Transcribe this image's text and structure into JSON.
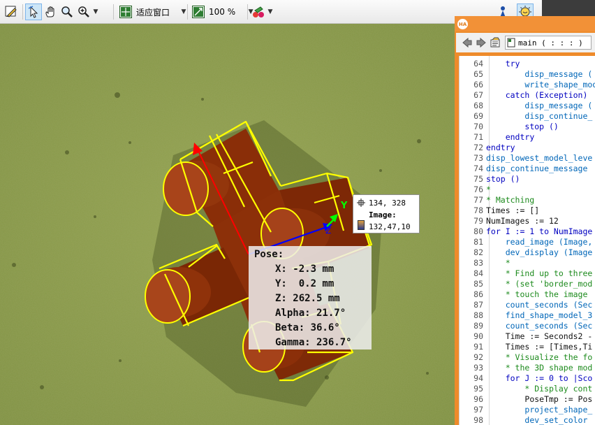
{
  "toolbar": {
    "zoom_fit_label": "适应窗口",
    "zoom_percent_label": "100 %"
  },
  "icons": {
    "edit": "pencil-edit-icon",
    "pointer": "pointer-arrow-icon",
    "pan": "pan-hand-icon",
    "magnify": "magnifier-icon",
    "zoom": "zoom-in-icon",
    "fit": "fit-window-icon",
    "scale": "zoom-scale-icon",
    "color": "color-paint-icon",
    "inspect": "inspect-icon",
    "lamp": "lamp-icon"
  },
  "graphics": {
    "pose": {
      "heading": "Pose:",
      "x": "X: -2.3 mm",
      "y": "Y:  0.2 mm",
      "z": "Z: 262.5 mm",
      "alpha": "Alpha: 21.7°",
      "beta": "Beta: 36.6°",
      "gamma": "Gamma: 236.7°"
    },
    "axis_labels": {
      "x": "X",
      "y": "Y",
      "z": "Z"
    },
    "pixel_info": {
      "coords": "134, 328",
      "label": "Image:",
      "value": "132,47,10"
    },
    "colors": {
      "background": "#8a9b4a",
      "object": "#8a2e08",
      "contour": "#ffff00"
    }
  },
  "program": {
    "logo": "HA",
    "procedure": "main ( : : : )",
    "lines": [
      {
        "n": "64",
        "indent": "    ",
        "parts": [
          {
            "c": "kw",
            "t": "try"
          }
        ]
      },
      {
        "n": "65",
        "indent": "        ",
        "parts": [
          {
            "c": "fn",
            "t": "disp_message ("
          }
        ]
      },
      {
        "n": "66",
        "indent": "        ",
        "parts": [
          {
            "c": "fn",
            "t": "write_shape_mod"
          }
        ]
      },
      {
        "n": "67",
        "indent": "    ",
        "parts": [
          {
            "c": "kw",
            "t": "catch (Exception)"
          }
        ]
      },
      {
        "n": "68",
        "indent": "        ",
        "parts": [
          {
            "c": "fn",
            "t": "disp_message ("
          }
        ]
      },
      {
        "n": "69",
        "indent": "        ",
        "parts": [
          {
            "c": "fn",
            "t": "disp_continue_"
          }
        ]
      },
      {
        "n": "70",
        "indent": "        ",
        "parts": [
          {
            "c": "kw",
            "t": "stop ()"
          }
        ]
      },
      {
        "n": "71",
        "indent": "    ",
        "parts": [
          {
            "c": "kw",
            "t": "endtry"
          }
        ]
      },
      {
        "n": "72",
        "indent": "",
        "parts": [
          {
            "c": "kw",
            "t": "endtry"
          }
        ]
      },
      {
        "n": "73",
        "indent": "",
        "parts": [
          {
            "c": "fn",
            "t": "disp_lowest_model_leve"
          }
        ]
      },
      {
        "n": "74",
        "indent": "",
        "parts": [
          {
            "c": "fn",
            "t": "disp_continue_message"
          }
        ]
      },
      {
        "n": "75",
        "indent": "",
        "parts": [
          {
            "c": "kw",
            "t": "stop ()"
          }
        ]
      },
      {
        "n": "76",
        "indent": "",
        "parts": [
          {
            "c": "cmt",
            "t": "*"
          }
        ]
      },
      {
        "n": "77",
        "indent": "",
        "parts": [
          {
            "c": "cmt",
            "t": "* Matching"
          }
        ]
      },
      {
        "n": "78",
        "indent": "",
        "parts": [
          {
            "c": "plain",
            "t": "Times := []"
          }
        ]
      },
      {
        "n": "79",
        "indent": "",
        "parts": [
          {
            "c": "plain",
            "t": "NumImages := 12"
          }
        ]
      },
      {
        "n": "80",
        "indent": "",
        "parts": [
          {
            "c": "kw",
            "t": "for I := 1 to NumImage"
          }
        ]
      },
      {
        "n": "81",
        "indent": "    ",
        "parts": [
          {
            "c": "fn",
            "t": "read_image (Image,"
          }
        ]
      },
      {
        "n": "82",
        "indent": "    ",
        "parts": [
          {
            "c": "fn",
            "t": "dev_display (Image"
          }
        ]
      },
      {
        "n": "83",
        "indent": "    ",
        "parts": [
          {
            "c": "cmt",
            "t": "*"
          }
        ]
      },
      {
        "n": "84",
        "indent": "    ",
        "parts": [
          {
            "c": "cmt",
            "t": "* Find up to three"
          }
        ]
      },
      {
        "n": "85",
        "indent": "    ",
        "parts": [
          {
            "c": "cmt",
            "t": "* (set 'border_mod"
          }
        ]
      },
      {
        "n": "86",
        "indent": "    ",
        "parts": [
          {
            "c": "cmt",
            "t": "* touch the image"
          }
        ]
      },
      {
        "n": "87",
        "indent": "    ",
        "parts": [
          {
            "c": "fn",
            "t": "count_seconds (Sec"
          }
        ]
      },
      {
        "n": "88",
        "indent": "    ",
        "parts": [
          {
            "c": "fn",
            "t": "find_shape_model_3"
          }
        ]
      },
      {
        "n": "89",
        "indent": "    ",
        "parts": [
          {
            "c": "fn",
            "t": "count_seconds (Sec"
          }
        ]
      },
      {
        "n": "90",
        "indent": "    ",
        "parts": [
          {
            "c": "plain",
            "t": "Time := Seconds2 -"
          }
        ]
      },
      {
        "n": "91",
        "indent": "    ",
        "parts": [
          {
            "c": "plain",
            "t": "Times := [Times,Ti"
          }
        ]
      },
      {
        "n": "92",
        "indent": "    ",
        "parts": [
          {
            "c": "cmt",
            "t": "* Visualize the fo"
          }
        ]
      },
      {
        "n": "93",
        "indent": "    ",
        "parts": [
          {
            "c": "cmt",
            "t": "* the 3D shape mod"
          }
        ]
      },
      {
        "n": "94",
        "indent": "    ",
        "parts": [
          {
            "c": "kw",
            "t": "for J := 0 to |Sco"
          }
        ]
      },
      {
        "n": "95",
        "indent": "        ",
        "parts": [
          {
            "c": "cmt",
            "t": "* Display cont"
          }
        ]
      },
      {
        "n": "96",
        "indent": "        ",
        "parts": [
          {
            "c": "plain",
            "t": "PoseTmp := Pos"
          }
        ]
      },
      {
        "n": "97",
        "indent": "        ",
        "parts": [
          {
            "c": "fn",
            "t": "project_shape_"
          }
        ]
      },
      {
        "n": "98",
        "indent": "        ",
        "parts": [
          {
            "c": "fn",
            "t": "dev_set_color"
          }
        ]
      }
    ]
  }
}
